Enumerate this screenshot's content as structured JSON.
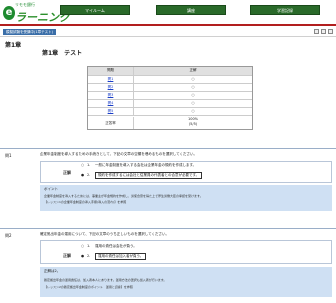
{
  "header": {
    "logo_small": "リモモ銀行",
    "logo_mark": "e",
    "logo_main": "ラーニング",
    "nav": [
      "マイルーム",
      "講座",
      "学習記録"
    ]
  },
  "subbar": {
    "label": "模擬試験を受講中(1章テスト)"
  },
  "chapter": "第1章",
  "test_title": "第1章　テスト",
  "result_table": {
    "headers": [
      "問題",
      "正解"
    ],
    "rows": [
      {
        "q": "問1",
        "mark": "○"
      },
      {
        "q": "問2",
        "mark": "○"
      },
      {
        "q": "問3",
        "mark": "○"
      },
      {
        "q": "問4",
        "mark": "○"
      },
      {
        "q": "問5",
        "mark": "○"
      }
    ],
    "rate_label": "正答率",
    "rate_value": "100%",
    "rate_detail": "(5/5)"
  },
  "questions": [
    {
      "num": "問1",
      "text": "企業年金制度を導入するための手続きとして、下記の文章の空欄を埋めるものを選択してください。",
      "answer_label": "正解",
      "choice1_mark": "○",
      "choice1_num": "1.",
      "choice1_text": "一般に年金制度を導入する会社は企業年金の規約を作成します。",
      "choice2_mark": "●",
      "choice2_num": "2.",
      "choice2_text": "規約を作成するには会社と従業員の代表者との合意が必要です。",
      "explain_title": "ポイント",
      "explain_lines": [
        "企業年金制度を導入するためには、事業主が年金規約を作成し、労使合意を得た上で厚生労働大臣の承認を受けます。",
        "【レッスン1の企業年金制度の導入手順(導入の流れ)】を参照"
      ]
    },
    {
      "num": "問2",
      "text": "確定拠出年金の運用について、下記の文章のうち正しいものを選択してください。",
      "answer_label": "正解",
      "choice1_mark": "○",
      "choice1_num": "1.",
      "choice1_text": "運用の責任は会社が負う。",
      "choice2_mark": "●",
      "choice2_num": "2.",
      "choice2_text": "運用の責任は加入者が負う。",
      "explain_title": "正解は2。",
      "explain_lines": [
        "確定拠出年金の運用責任は、加入者本人にあります。運用方法の選択も加入者が行います。",
        "【レッスン2の確定拠出年金制度のポイント　運用と資産】を参照"
      ]
    }
  ],
  "colors": {
    "accent": "#2a6a2a",
    "header_line": "#b21e1e",
    "explain_bg": "#cfe0f3",
    "link": "#1a3ec8"
  }
}
